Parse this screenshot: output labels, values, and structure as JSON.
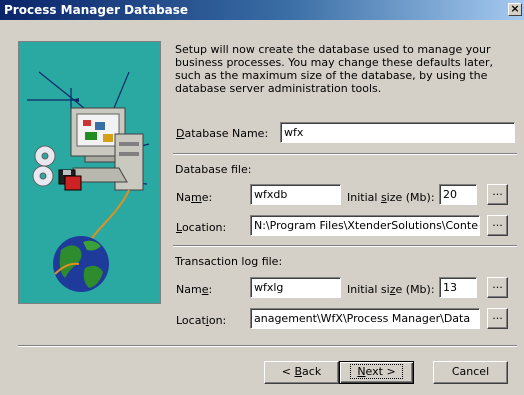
{
  "window": {
    "title": "Process Manager Database",
    "close_label": "×"
  },
  "intro_text": "Setup will now create the database used to manage your business processes. You may change these defaults later, such as the maximum size of the database, by using the database server administration tools.",
  "database_name": {
    "label_pre": "",
    "label_u": "D",
    "label_post": "atabase Name:",
    "value": "wfx"
  },
  "database_file": {
    "heading": "Database file:",
    "name": {
      "label_pre": "Na",
      "label_u": "m",
      "label_post": "e:",
      "value": "wfxdb"
    },
    "size": {
      "label_pre": "Initial ",
      "label_u": "s",
      "label_post": "ize (Mb):",
      "value": "20"
    },
    "location": {
      "label_pre": "",
      "label_u": "L",
      "label_post": "ocation:",
      "value": "N:\\Program Files\\XtenderSolutions\\Conten"
    },
    "browse_label": "..."
  },
  "log_file": {
    "heading": "Transaction log file:",
    "name": {
      "label_pre": "Nam",
      "label_u": "e",
      "label_post": ":",
      "value": "wfxlg"
    },
    "size": {
      "label_pre": "Initial si",
      "label_u": "z",
      "label_post": "e (Mb):",
      "value": "13"
    },
    "location": {
      "label_pre": "Locat",
      "label_u": "i",
      "label_post": "on:",
      "value": "anagement\\WfX\\Process Manager\\Data"
    },
    "browse_label": "..."
  },
  "buttons": {
    "back": {
      "pre": "< ",
      "u": "B",
      "post": "ack"
    },
    "next": {
      "pre": "",
      "u": "N",
      "post": "ext >"
    },
    "cancel": "Cancel"
  },
  "colors": {
    "art_background": "#2aa9a2",
    "titlebar_start": "#0a246a",
    "titlebar_end": "#a6caf0",
    "dialog_face": "#d4d0c8"
  }
}
